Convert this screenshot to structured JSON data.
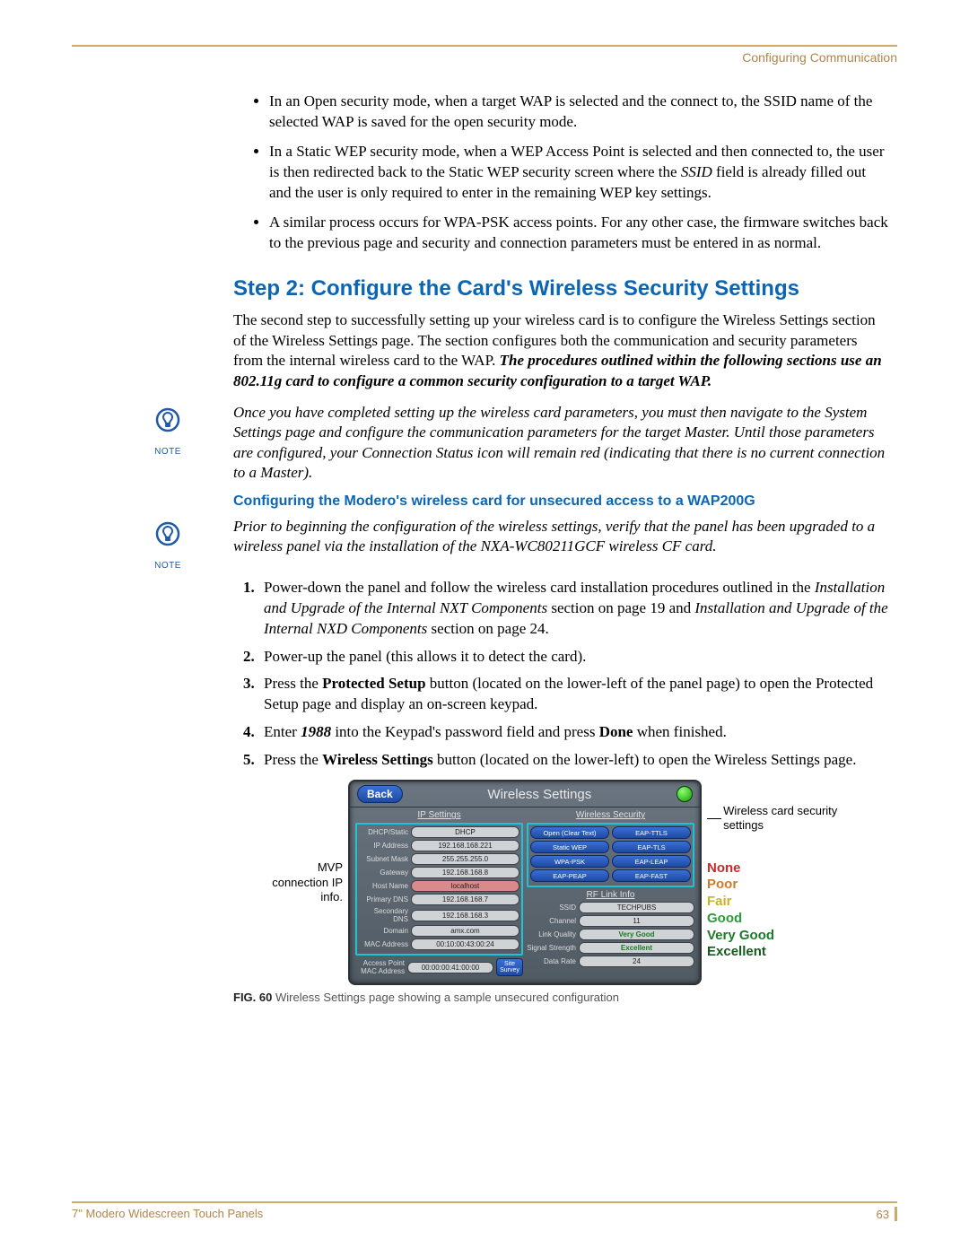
{
  "header": {
    "breadcrumb": "Configuring Communication"
  },
  "bullets": [
    "In an Open security mode, when a target WAP is selected and the connect to, the SSID name of the selected WAP is saved for the open security mode.",
    "In a Static WEP security mode, when a WEP Access Point is selected and then connected to, the user is then redirected back to the Static WEP security screen where the SSID field is already filled out and the user is only required to enter in the remaining WEP key settings.",
    "A similar process occurs for WPA-PSK access points. For any other case, the firmware switches back to the previous page and security and connection parameters must be entered in as normal."
  ],
  "step2": {
    "heading": "Step 2: Configure the Card's Wireless Security Settings",
    "intro_plain": "The second step to successfully setting up your wireless card is to configure the Wireless Settings section of the Wireless Settings page. The section configures both the communication and security parameters from the internal wireless card to the WAP. ",
    "intro_bold": "The procedures outlined within the following sections use an 802.11g card to configure a common security configuration to a target WAP."
  },
  "note1": {
    "label": "NOTE",
    "text": "Once you have completed setting up the wireless card parameters, you must then navigate to the System Settings page and configure the communication parameters for the target Master. Until those parameters are configured, your Connection Status icon will remain red (indicating that there is no current connection to a Master)."
  },
  "subhead": "Configuring the Modero's wireless card for unsecured access to a WAP200G",
  "note2": {
    "label": "NOTE",
    "text": "Prior to beginning the configuration of the wireless settings, verify that the panel has been upgraded to a wireless panel via the installation of the NXA-WC80211GCF wireless CF card."
  },
  "steps": [
    {
      "pre": "Power-down the panel and follow the wireless card installation procedures outlined in the ",
      "ital": "Installation and Upgrade of the Internal NXT Components",
      "mid": " section on page 19 and ",
      "ital2": "Installation and Upgrade of the Internal NXD Components",
      "post": " section on page 24."
    },
    {
      "pre": "Power-up the panel (this allows it to detect the card)."
    },
    {
      "pre": "Press the ",
      "b": "Protected Setup",
      "post": " button (located on the lower-left of the panel page) to open the Protected Setup page and display an on-screen keypad."
    },
    {
      "pre": "Enter ",
      "bi": "1988",
      "mid": " into the Keypad's password field and press ",
      "b": "Done",
      "post": " when finished."
    },
    {
      "pre": "Press the ",
      "b": "Wireless Settings",
      "post": " button (located on the lower-left) to open the Wireless Settings page."
    }
  ],
  "figure": {
    "left_label": "MVP connection IP info.",
    "right_label": "Wireless card security settings",
    "caption_bold": "FIG. 60",
    "caption_rest": "  Wireless Settings page showing a sample unsecured configuration",
    "panel": {
      "back": "Back",
      "title": "Wireless Settings",
      "ip_title": "IP Settings",
      "sec_title": "Wireless Security",
      "rf_title": "RF Link Info",
      "ip": [
        {
          "l": "DHCP/Static",
          "v": "DHCP"
        },
        {
          "l": "IP Address",
          "v": "192.168.168.221"
        },
        {
          "l": "Subnet Mask",
          "v": "255.255.255.0"
        },
        {
          "l": "Gateway",
          "v": "192.168.168.8"
        },
        {
          "l": "Host Name",
          "v": "localhost",
          "red": true
        },
        {
          "l": "Primary DNS",
          "v": "192.168.168.7"
        },
        {
          "l": "Secondary DNS",
          "v": "192.168.168.3"
        },
        {
          "l": "Domain",
          "v": "amx.com"
        },
        {
          "l": "MAC Address",
          "v": "00:10:00:43:00:24"
        }
      ],
      "ap_label": "Access Point MAC Address",
      "ap_mac": "00:00:00:41:00:00",
      "site_survey": "Site Survey",
      "security": [
        [
          "Open (Clear Text)",
          "EAP-TTLS"
        ],
        [
          "Static WEP",
          "EAP-TLS"
        ],
        [
          "WPA-PSK",
          "EAP-LEAP"
        ],
        [
          "EAP-PEAP",
          "EAP-FAST"
        ]
      ],
      "rf": [
        {
          "l": "SSID",
          "v": "TECHPUBS"
        },
        {
          "l": "Channel",
          "v": "11"
        },
        {
          "l": "Link Quality",
          "v": "Very Good",
          "g": true
        },
        {
          "l": "Signal Strength",
          "v": "Excellent",
          "g": true
        },
        {
          "l": "Data Rate",
          "v": "24"
        }
      ]
    },
    "quality": [
      "None",
      "Poor",
      "Fair",
      "Good",
      "Very Good",
      "Excellent"
    ]
  },
  "footer": {
    "left": "7\" Modero Widescreen Touch Panels",
    "page": "63"
  }
}
